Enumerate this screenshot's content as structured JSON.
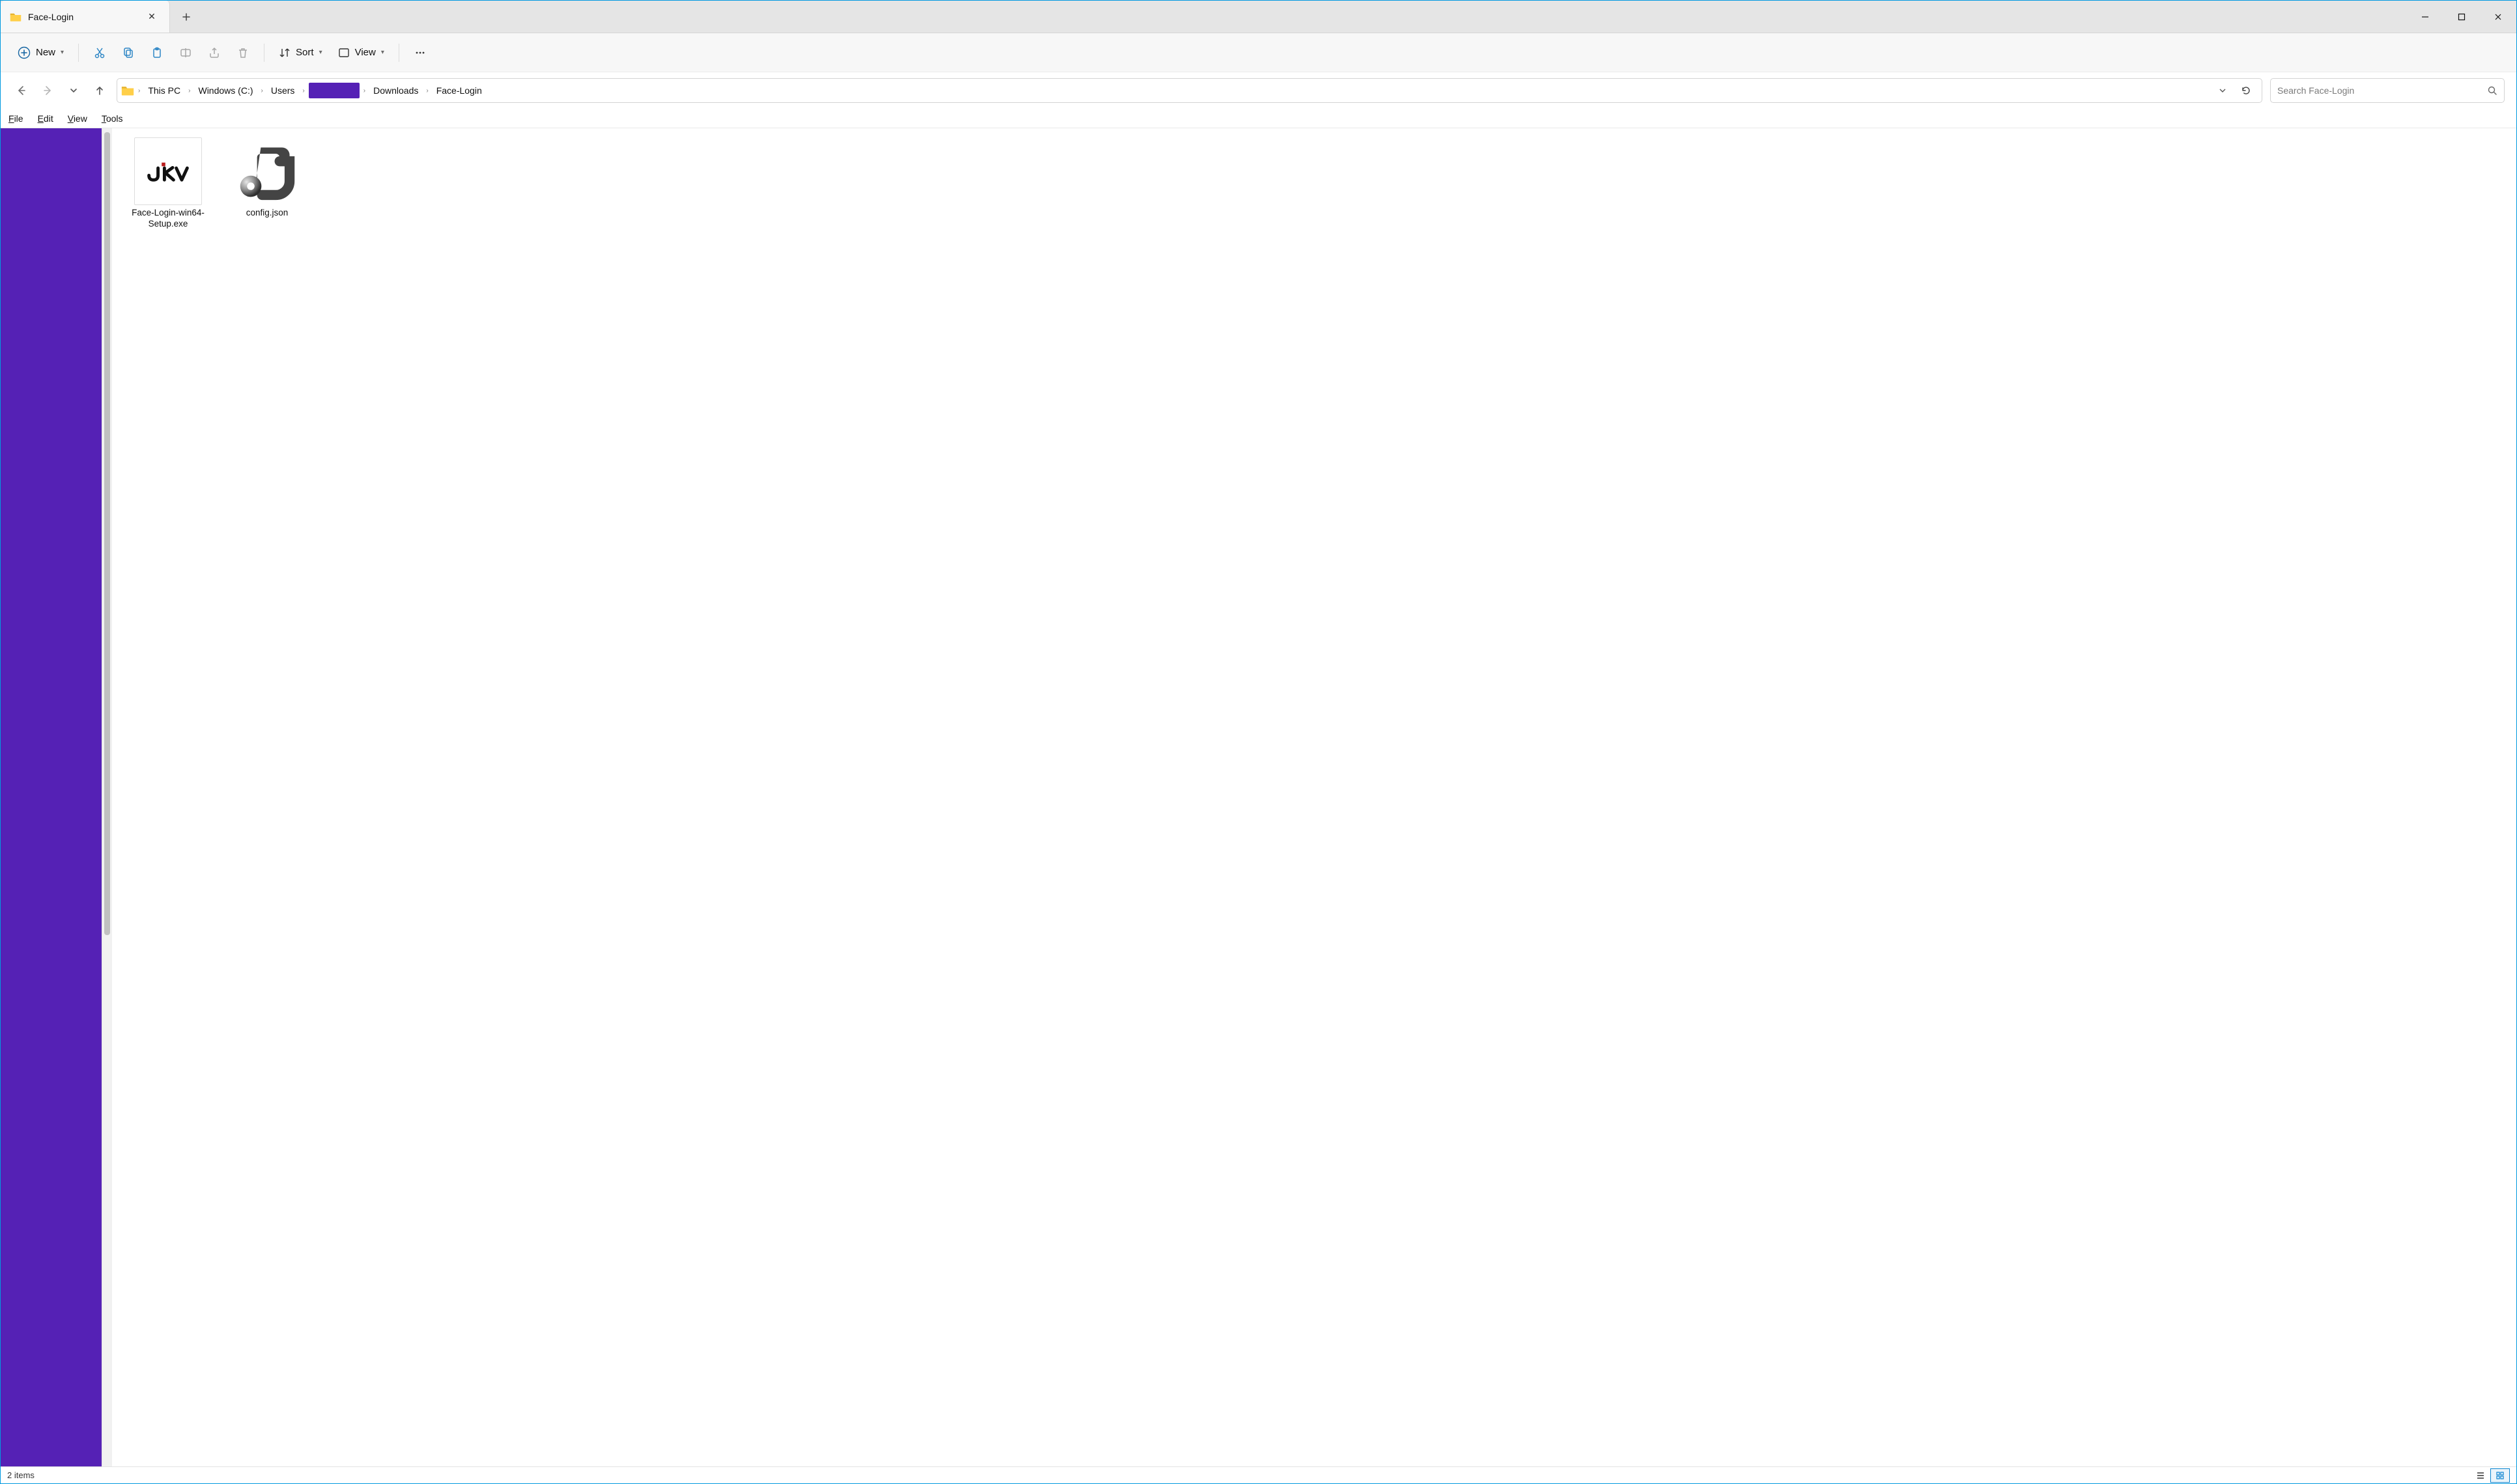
{
  "tab": {
    "title": "Face-Login"
  },
  "toolbar": {
    "new_label": "New",
    "sort_label": "Sort",
    "view_label": "View"
  },
  "breadcrumb": {
    "items": [
      {
        "label": "This PC"
      },
      {
        "label": "Windows (C:)"
      },
      {
        "label": "Users"
      },
      {
        "label": "",
        "redacted": true
      },
      {
        "label": "Downloads"
      },
      {
        "label": "Face-Login"
      }
    ]
  },
  "search": {
    "placeholder": "Search Face-Login"
  },
  "menu": {
    "file": "File",
    "edit": "Edit",
    "view": "View",
    "tools": "Tools"
  },
  "files": [
    {
      "name": "Face-Login-win64-Setup.exe",
      "type": "exe"
    },
    {
      "name": "config.json",
      "type": "json"
    }
  ],
  "status": {
    "count_text": "2 items"
  }
}
